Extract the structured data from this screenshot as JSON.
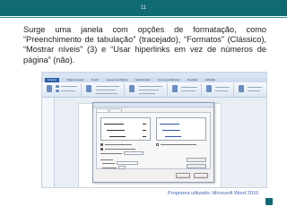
{
  "slide": {
    "page_number": "11",
    "body_text": "Surge uma janela com opções de formatação, como “Preenchimento de tabulação” (tracejado), “Formatos” (Clássico), “Mostrar níveis” (3) e “Usar hiperlinks em vez de números de página” (não).",
    "caption": "Programa utilizado: Microsoft Word 2010",
    "accent_color": "#0f6a73"
  },
  "screenshot": {
    "app": "Microsoft Word 2010",
    "ribbon_tabs": [
      "Arquivo",
      "Página Inicial",
      "Inserir",
      "Layout da Página",
      "Referências",
      "Correspondências",
      "Revisão",
      "Exibição"
    ],
    "dialog": {
      "tabs": [
        "Índice remissivo",
        "Sumário"
      ],
      "active_tab": "Sumário",
      "print_preview_entries": [
        "Título 1",
        "Título 2"
      ],
      "web_preview_entries": [
        "Título 1",
        "Título 2"
      ],
      "options": {
        "show_page_numbers": true,
        "right_align_page_numbers": true,
        "tab_leader": "tracejado",
        "formats": "Clássico",
        "show_levels": "3",
        "use_hyperlinks_instead_of_page_numbers": false
      },
      "buttons": [
        "Opções...",
        "Modificar...",
        "OK",
        "Cancelar"
      ]
    }
  }
}
